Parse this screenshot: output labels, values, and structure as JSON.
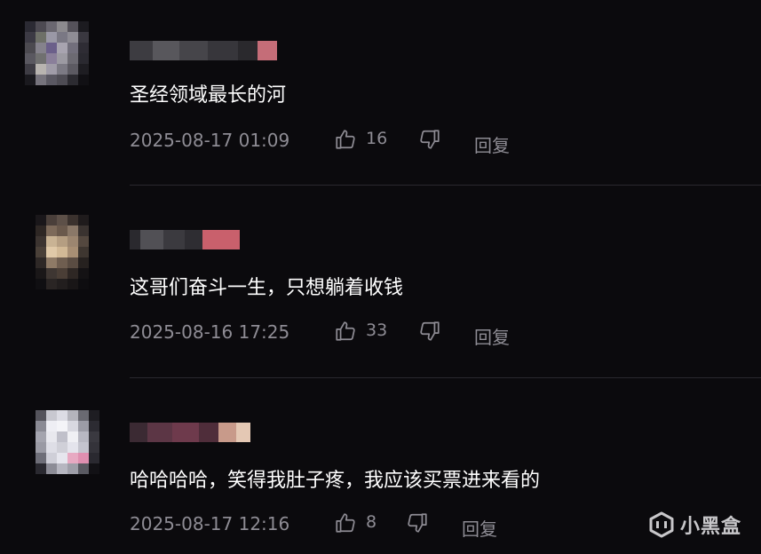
{
  "comments": [
    {
      "text": "圣经领域最长的河",
      "time": "2025-08-17 01:09",
      "likes": "16",
      "reply_label": "回复"
    },
    {
      "text": "这哥们奋斗一生，只想躺着收钱",
      "time": "2025-08-16 17:25",
      "likes": "33",
      "reply_label": "回复"
    },
    {
      "text": "哈哈哈哈，笑得我肚子疼，我应该买票进来看的",
      "time": "2025-08-17 12:16",
      "likes": "8",
      "reply_label": "回复"
    }
  ],
  "watermark": {
    "text": "小黑盒",
    "icon": "xiaoheihe-logo-icon"
  },
  "icons": {
    "like": "thumbs-up-icon",
    "dislike": "thumbs-down-icon"
  },
  "colors": {
    "background": "#0b0a0d",
    "meta_text": "#8e8c94",
    "divider": "#2a282e"
  }
}
